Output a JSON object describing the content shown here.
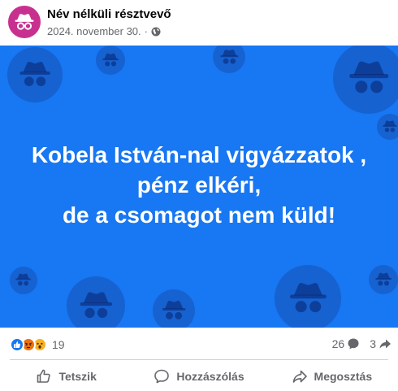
{
  "post": {
    "author": "Név nélküli résztvevő",
    "date": "2024. november 30.",
    "separator": "·",
    "privacy_icon": "globe-icon",
    "avatar_icon": "anonymous-incognito-icon",
    "colors": {
      "avatar_bg": "#c8308f",
      "image_bg": "#1877f2",
      "text": "#ffffff"
    },
    "text_lines": [
      "Kobela István-nal vigyázzatok ,",
      "pénz elkéri,",
      "de a csomagot nem küld!"
    ]
  },
  "stats": {
    "reaction_icons": [
      "like-icon",
      "angry-icon",
      "wow-icon"
    ],
    "reaction_count": "19",
    "comment_count": "26",
    "share_count": "3"
  },
  "actions": {
    "like_label": "Tetszik",
    "comment_label": "Hozzászólás",
    "share_label": "Megosztás"
  }
}
